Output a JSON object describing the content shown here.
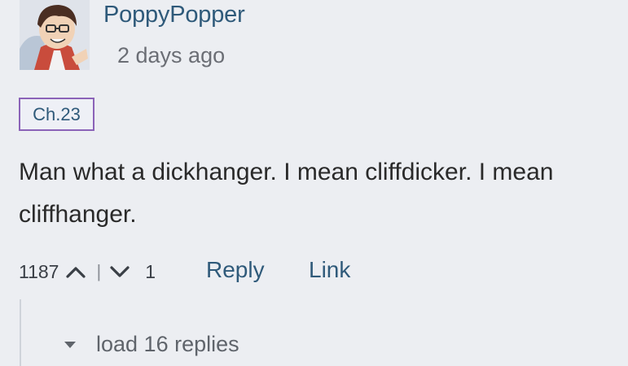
{
  "comment": {
    "username": "PoppyPopper",
    "timestamp": "2 days ago",
    "chapter": "Ch.23",
    "text": "Man what a dickhanger. I mean cliffdicker. I mean cliffhanger.",
    "upvotes": "1187",
    "separator": "|",
    "downvotes": "1",
    "reply_label": "Reply",
    "link_label": "Link",
    "load_replies_label": "load 16 replies"
  },
  "colors": {
    "background": "#eceef2",
    "link": "#2f5a7a",
    "badge_border": "#8b63b8"
  },
  "icons": {
    "avatar": "anime-character-avatar",
    "upvote": "chevron-up-icon",
    "downvote": "chevron-down-icon",
    "expand": "caret-down-icon"
  }
}
